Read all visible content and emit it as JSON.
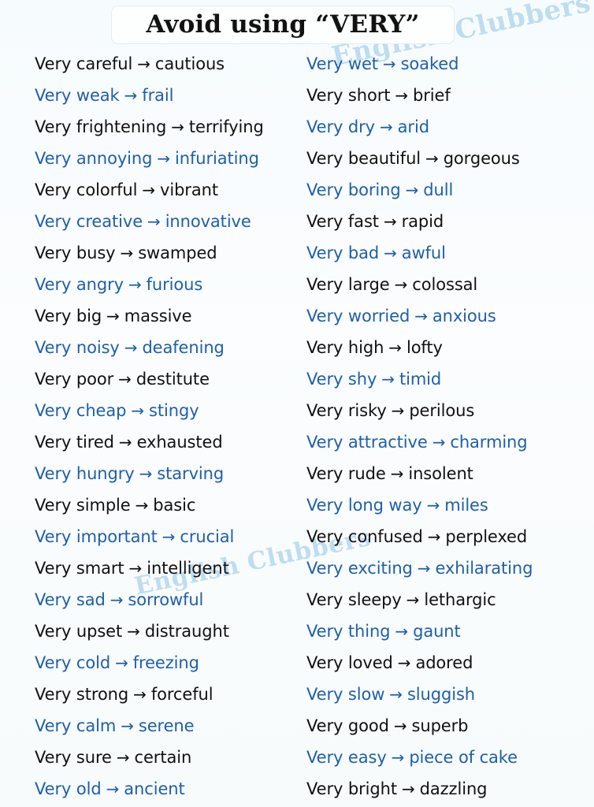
{
  "title": "Avoid using “VERY”",
  "watermark": {
    "top": "English Clubbers",
    "middle": "English Clubbers"
  },
  "arrow_glyph": "→",
  "colors": {
    "background": "#f7fbfc",
    "black_text": "#111111",
    "blue_text": "#1f5fa9",
    "watermark": "#bcdcf0",
    "title_border": "#e2eef2"
  },
  "columns": {
    "left": [
      {
        "word": "Very careful",
        "synonym": "cautious",
        "color": "black"
      },
      {
        "word": "Very weak",
        "synonym": "frail",
        "color": "blue"
      },
      {
        "word": "Very frightening",
        "synonym": "terrifying",
        "color": "black"
      },
      {
        "word": "Very annoying",
        "synonym": "infuriating",
        "color": "blue"
      },
      {
        "word": "Very colorful",
        "synonym": "vibrant",
        "color": "black"
      },
      {
        "word": "Very creative",
        "synonym": "innovative",
        "color": "blue"
      },
      {
        "word": "Very busy",
        "synonym": "swamped",
        "color": "black"
      },
      {
        "word": "Very angry",
        "synonym": "furious",
        "color": "blue"
      },
      {
        "word": "Very big",
        "synonym": "massive",
        "color": "black"
      },
      {
        "word": "Very noisy",
        "synonym": "deafening",
        "color": "blue"
      },
      {
        "word": "Very poor",
        "synonym": "destitute",
        "color": "black"
      },
      {
        "word": "Very cheap",
        "synonym": "stingy",
        "color": "blue"
      },
      {
        "word": "Very tired",
        "synonym": "exhausted",
        "color": "black"
      },
      {
        "word": "Very hungry",
        "synonym": "starving",
        "color": "blue"
      },
      {
        "word": "Very simple",
        "synonym": "basic",
        "color": "black"
      },
      {
        "word": "Very important",
        "synonym": "crucial",
        "color": "blue"
      },
      {
        "word": "Very smart",
        "synonym": "intelligent",
        "color": "black"
      },
      {
        "word": "Very sad",
        "synonym": "sorrowful",
        "color": "blue"
      },
      {
        "word": "Very upset",
        "synonym": "distraught",
        "color": "black"
      },
      {
        "word": "Very cold",
        "synonym": "freezing",
        "color": "blue"
      },
      {
        "word": "Very strong",
        "synonym": "forceful",
        "color": "black"
      },
      {
        "word": "Very calm",
        "synonym": "serene",
        "color": "blue"
      },
      {
        "word": "Very sure",
        "synonym": "certain",
        "color": "black"
      },
      {
        "word": "Very old",
        "synonym": "ancient",
        "color": "blue"
      }
    ],
    "right": [
      {
        "word": "Very wet",
        "synonym": "soaked",
        "color": "blue"
      },
      {
        "word": "Very short",
        "synonym": "brief",
        "color": "black"
      },
      {
        "word": "Very dry",
        "synonym": "arid",
        "color": "blue"
      },
      {
        "word": "Very beautiful",
        "synonym": "gorgeous",
        "color": "black"
      },
      {
        "word": "Very boring",
        "synonym": "dull",
        "color": "blue"
      },
      {
        "word": "Very fast",
        "synonym": "rapid",
        "color": "black"
      },
      {
        "word": "Very bad",
        "synonym": "awful",
        "color": "blue"
      },
      {
        "word": "Very large",
        "synonym": "colossal",
        "color": "black"
      },
      {
        "word": "Very worried",
        "synonym": "anxious",
        "color": "blue"
      },
      {
        "word": "Very high",
        "synonym": "lofty",
        "color": "black"
      },
      {
        "word": "Very shy",
        "synonym": "timid",
        "color": "blue"
      },
      {
        "word": "Very risky",
        "synonym": "perilous",
        "color": "black"
      },
      {
        "word": "Very attractive",
        "synonym": "charming",
        "color": "blue"
      },
      {
        "word": "Very rude",
        "synonym": "insolent",
        "color": "black"
      },
      {
        "word": "Very long way",
        "synonym": "miles",
        "color": "blue"
      },
      {
        "word": "Very confused",
        "synonym": "perplexed",
        "color": "black"
      },
      {
        "word": "Very exciting",
        "synonym": "exhilarating",
        "color": "blue"
      },
      {
        "word": "Very sleepy",
        "synonym": "lethargic",
        "color": "black"
      },
      {
        "word": "Very thing",
        "synonym": "gaunt",
        "color": "blue"
      },
      {
        "word": "Very loved",
        "synonym": "adored",
        "color": "black"
      },
      {
        "word": "Very slow",
        "synonym": "sluggish",
        "color": "blue"
      },
      {
        "word": "Very good",
        "synonym": "superb",
        "color": "black"
      },
      {
        "word": "Very easy",
        "synonym": "piece of cake",
        "color": "blue"
      },
      {
        "word": "Very bright",
        "synonym": "dazzling",
        "color": "black"
      }
    ]
  }
}
